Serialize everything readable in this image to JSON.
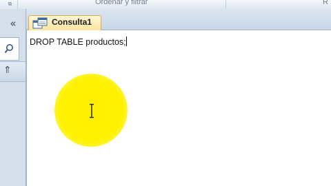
{
  "ribbon": {
    "group_sort_filter": "Ordenar y filtrar",
    "group_right_partial": "R"
  },
  "navigation_pane": {
    "collapse_glyph": "«",
    "section_chevron": "⇑"
  },
  "document_tabs": [
    {
      "label": "Consulta1",
      "icon": "query-icon",
      "active": true
    }
  ],
  "sql_view": {
    "text": "DROP TABLE productos;"
  },
  "colors": {
    "tab_active": "#fde39c",
    "highlight": "#fff000",
    "nav_bg": "#d5dfeb"
  }
}
